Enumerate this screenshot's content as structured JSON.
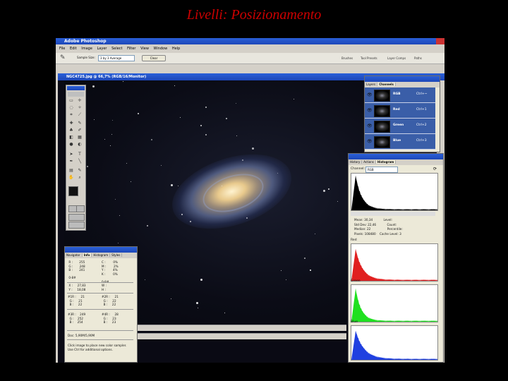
{
  "slide": {
    "title": "Livelli: Posizionamento"
  },
  "app": {
    "title": "Adobe Photoshop",
    "menu": [
      "File",
      "Edit",
      "Image",
      "Layer",
      "Select",
      "Filter",
      "View",
      "Window",
      "Help"
    ],
    "options": {
      "sample_size_label": "Sample Size:",
      "sample_size_value": "3 by 3 Average",
      "clear_label": "Clear"
    },
    "palette_tabs": [
      "Brushes",
      "Tool Presets",
      "Layer Comps",
      "Paths"
    ]
  },
  "document": {
    "title": "NGC4725.jpg @ 66,7% (RGB/16/Monitor)"
  },
  "channels_panel": {
    "tabs": [
      "Layers",
      "Channels"
    ],
    "channels": [
      {
        "name": "RGB",
        "shortcut": "Ctrl+~"
      },
      {
        "name": "Red",
        "shortcut": "Ctrl+1"
      },
      {
        "name": "Green",
        "shortcut": "Ctrl+2"
      },
      {
        "name": "Blue",
        "shortcut": "Ctrl+3"
      }
    ]
  },
  "histogram_panel": {
    "tabs": [
      "History",
      "Actions",
      "Histogram"
    ],
    "channel_label": "Channel:",
    "channel_value": "RGB",
    "stats": {
      "mean_label": "Mean:",
      "mean": "30,34",
      "stddev_label": "Std Dev:",
      "stddev": "22,46",
      "median_label": "Median:",
      "median": "22",
      "pixels_label": "Pixels:",
      "pixels": "108480",
      "level_label": "Level:",
      "count_label": "Count:",
      "percentile_label": "Percentile:",
      "cache_label": "Cache Level:",
      "cache": "3"
    },
    "sections": [
      "Red",
      "Green",
      "Blue"
    ],
    "colors": {
      "rgb": "#000000",
      "red": "#e02020",
      "green": "#20e020",
      "blue": "#2040e0"
    }
  },
  "info_panel": {
    "tabs": [
      "Navigator",
      "Info",
      "Histogram",
      "Styles"
    ],
    "rgb_block": " R :       255\n G :       248\n B :       241\n\n 0-8#",
    "cmyk_block": "C :        0%\nM :        2%\nY :        4%\nK :        0%\n\n0-8#",
    "xy_block": " X :     27,83\n Y :     18,08",
    "wh_block": "W :\nH :",
    "sample1": "#1R :     21\n  G :     21\n  B :     22",
    "sample2": "#2R :     21\n  G :     22\n  B :     22",
    "sample3": "#3R :    249\n  G :    252\n  B :    254",
    "sample4": "#4R :     28\n  G :     23\n  B :     23",
    "doc_line": "Doc: 5,90M/5,90M",
    "hint": "Click image to place new color sampler.\nUse Ctrl for additional options."
  }
}
